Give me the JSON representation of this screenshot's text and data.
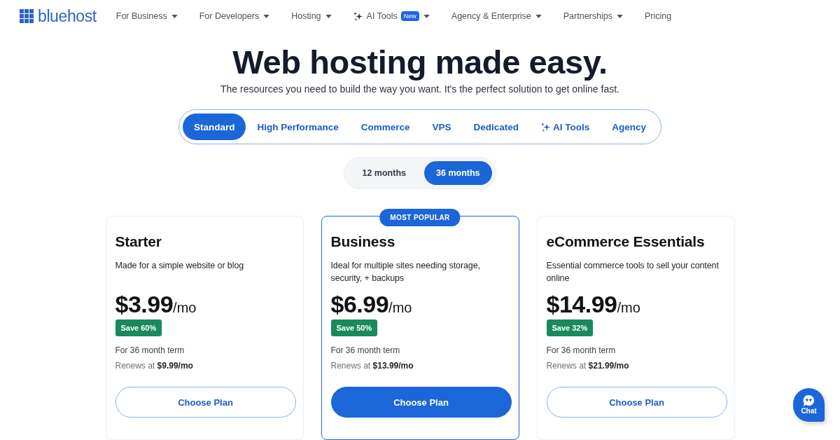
{
  "logo": {
    "text": "bluehost"
  },
  "nav": [
    {
      "label": "For Business",
      "kind": "text",
      "dropdown": true
    },
    {
      "label": "For Developers",
      "kind": "text",
      "dropdown": true
    },
    {
      "label": "Hosting",
      "kind": "text",
      "dropdown": true
    },
    {
      "label": "AI Tools",
      "kind": "ai",
      "badge": "New",
      "dropdown": true
    },
    {
      "label": "Agency & Enterprise",
      "kind": "text",
      "dropdown": true
    },
    {
      "label": "Partnerships",
      "kind": "text",
      "dropdown": true
    },
    {
      "label": "Pricing",
      "kind": "text",
      "dropdown": false
    }
  ],
  "hero": {
    "title": "Web hosting made easy.",
    "subtitle": "The resources you need to build the way you want. It's the perfect solution to get online fast."
  },
  "tabs": [
    {
      "label": "Standard",
      "kind": "text",
      "selected": true
    },
    {
      "label": "High Performance",
      "kind": "text",
      "selected": false
    },
    {
      "label": "Commerce",
      "kind": "text",
      "selected": false
    },
    {
      "label": "VPS",
      "kind": "text",
      "selected": false
    },
    {
      "label": "Dedicated",
      "kind": "text",
      "selected": false
    },
    {
      "label": "AI Tools",
      "kind": "ai",
      "selected": false
    },
    {
      "label": "Agency",
      "kind": "text",
      "selected": false
    }
  ],
  "terms": [
    {
      "label": "12 months",
      "selected": false
    },
    {
      "label": "36 months",
      "selected": true
    }
  ],
  "plans": [
    {
      "name": "Starter",
      "featured": false,
      "description": "Made for a simple website or blog",
      "price": "$3.99",
      "unit": "/mo",
      "save": "Save 60%",
      "term": "For 36 month term",
      "renews": "Renews at **$9.99/mo**",
      "button": "Choose Plan"
    },
    {
      "name": "Business",
      "featured": true,
      "ribbon": "MOST POPULAR",
      "description": "Ideal for multiple sites needing storage, security, + backups",
      "price": "$6.99",
      "unit": "/mo",
      "save": "Save 50%",
      "term": "For 36 month term",
      "renews": "Renews at **$13.99/mo**",
      "button": "Choose Plan"
    },
    {
      "name": "eCommerce Essentials",
      "featured": false,
      "description": "Essential commerce tools to sell your content online",
      "price": "$14.99",
      "unit": "/mo",
      "save": "Save 32%",
      "term": "For 36 month term",
      "renews": "Renews at **$21.99/mo**",
      "button": "Choose Plan"
    }
  ],
  "chat": {
    "label": "Chat"
  }
}
